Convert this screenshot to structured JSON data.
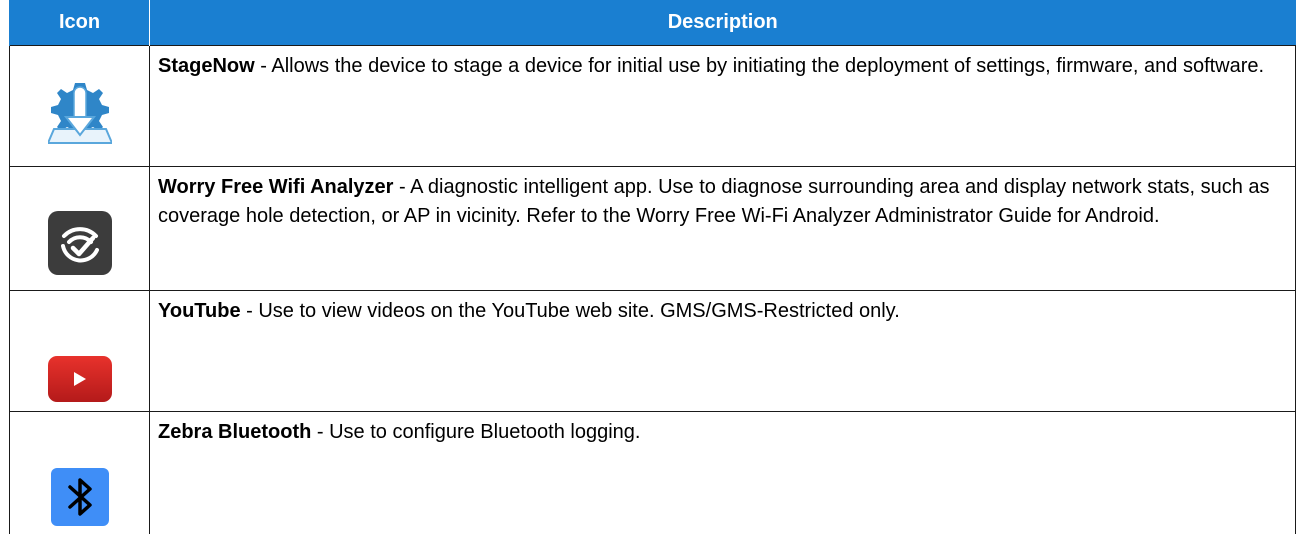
{
  "table": {
    "headers": {
      "icon": "Icon",
      "description": "Description"
    },
    "rows": [
      {
        "icon": "stagenow-icon",
        "name": "StageNow",
        "text": " - Allows the device to stage a device for initial use by initiating the deployment of settings, firmware, and software."
      },
      {
        "icon": "worry-free-wifi-analyzer-icon",
        "name": "Worry Free Wifi Analyzer",
        "text": " - A diagnostic intelligent app. Use to diagnose surrounding area and display network stats, such as coverage hole detection, or AP in vicinity. Refer to the Worry Free Wi-Fi Analyzer Administrator Guide for Android."
      },
      {
        "icon": "youtube-icon",
        "name": "YouTube",
        "text": " - Use to view videos on the YouTube web site. GMS/GMS-Restricted only."
      },
      {
        "icon": "bluetooth-icon",
        "name": "Zebra Bluetooth",
        "text": " - Use to configure Bluetooth logging."
      }
    ]
  },
  "colors": {
    "header_bg": "#1a7fd1",
    "header_text": "#ffffff"
  }
}
